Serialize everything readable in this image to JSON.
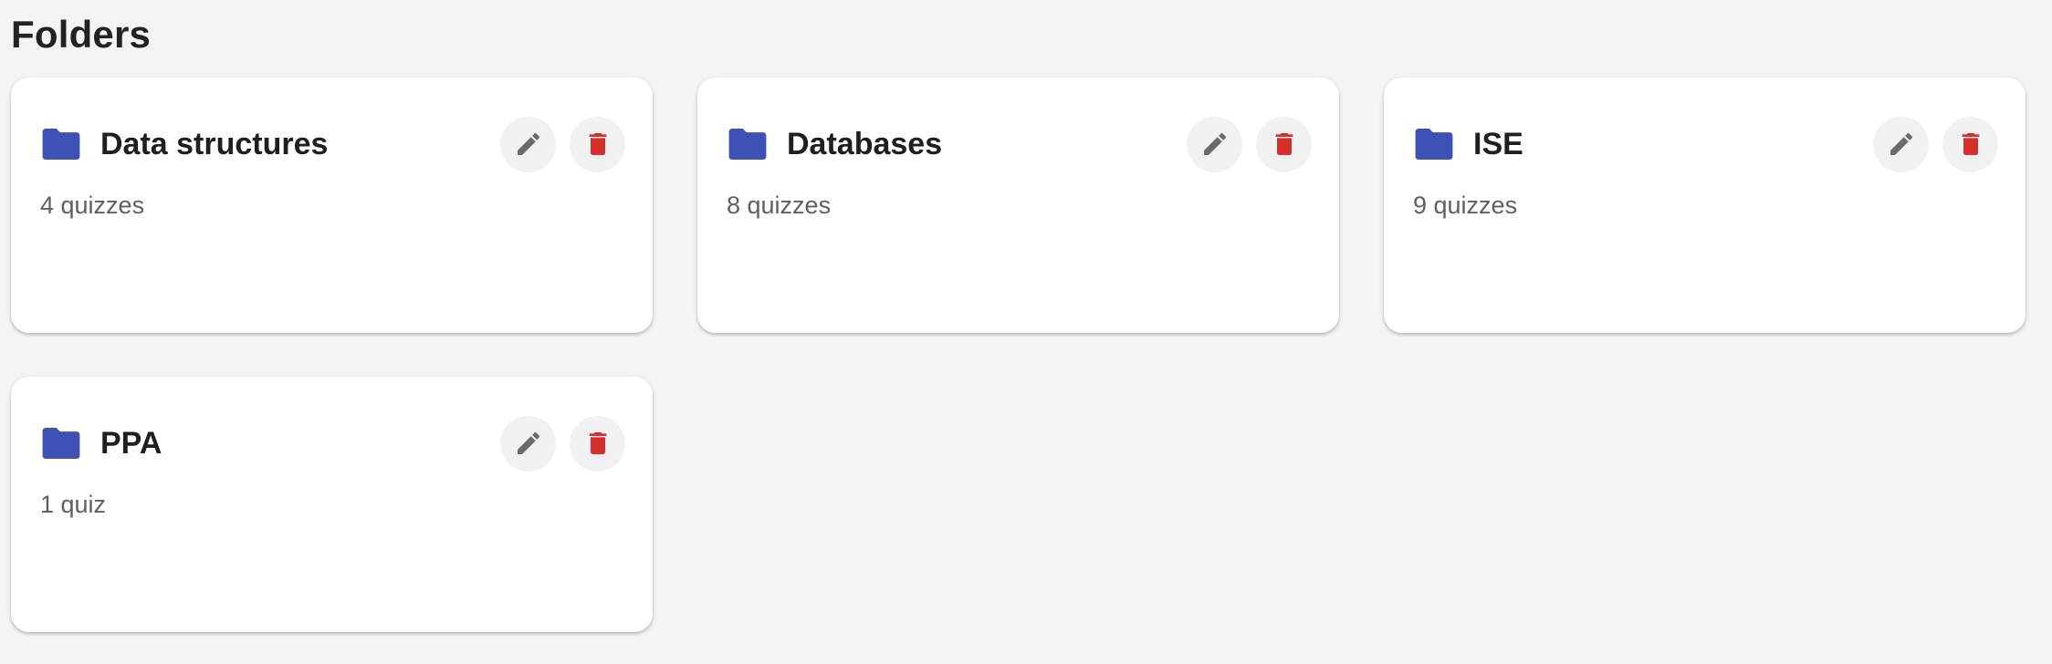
{
  "page": {
    "title": "Folders"
  },
  "colors": {
    "background": "#f4f4f4",
    "folder_icon": "#3f51b5",
    "edit_icon": "#6b6b6b",
    "delete_icon": "#d32f2f"
  },
  "folders": [
    {
      "name": "Data structures",
      "count_label": "4 quizzes",
      "icon": "folder-icon"
    },
    {
      "name": "Databases",
      "count_label": "8 quizzes",
      "icon": "folder-icon"
    },
    {
      "name": "ISE",
      "count_label": "9 quizzes",
      "icon": "folder-icon"
    },
    {
      "name": "PPA",
      "count_label": "1 quiz",
      "icon": "folder-icon"
    }
  ],
  "actions": {
    "edit_icon": "pencil-icon",
    "delete_icon": "trash-icon"
  }
}
